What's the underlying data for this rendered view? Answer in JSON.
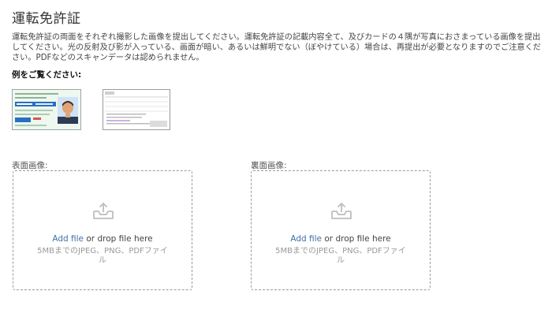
{
  "page": {
    "title": "運転免許証",
    "description": "運転免許証の両面をそれぞれ撮影した画像を提出してください。運転免許証の記載内容全て、及びカードの４隅が写真におさまっている画像を提出してください。光の反射及び影が入っている、画面が暗い、あるいは鮮明でない（ぼやけている）場合は、再提出が必要となりますのでご注意ください。PDFなどのスキャンデータは認められません。",
    "examples_label": "例をご覧ください:"
  },
  "uploads": [
    {
      "label": "表面画像:",
      "add_link": "Add file",
      "drop_text": " or drop file here",
      "formats": "5MBまでのJPEG、PNG、PDFファイル"
    },
    {
      "label": "裏面画像:",
      "add_link": "Add file",
      "drop_text": " or drop file here",
      "formats": "5MBまでのJPEG、PNG、PDFファイル"
    }
  ],
  "colors": {
    "link": "#3d6fa8",
    "card_blue": "#2a6fc2",
    "card_green": "#bfe6c8",
    "dashed_border": "#9a9a9a"
  },
  "icons": {
    "upload": "upload-tray-icon"
  }
}
